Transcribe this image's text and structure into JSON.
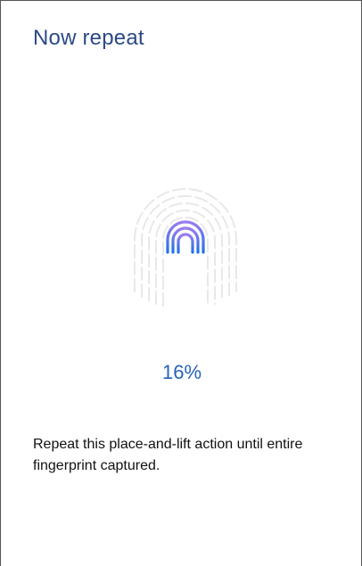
{
  "screen": {
    "title": "Now repeat",
    "progress_text": "16%",
    "progress": 0.16,
    "instructions": "Repeat this place-and-lift action until entire fingerprint captured."
  },
  "icons": {
    "fingerprint": "fingerprint-icon"
  },
  "colors": {
    "title": "#2c4a86",
    "accent": "#2563b8",
    "fingerprint_gradient_top": "#9b7cf0",
    "fingerprint_gradient_bottom": "#1f73e8",
    "fingerprint_faint": "#e6e6e6",
    "text": "#111111",
    "background": "#ffffff"
  }
}
